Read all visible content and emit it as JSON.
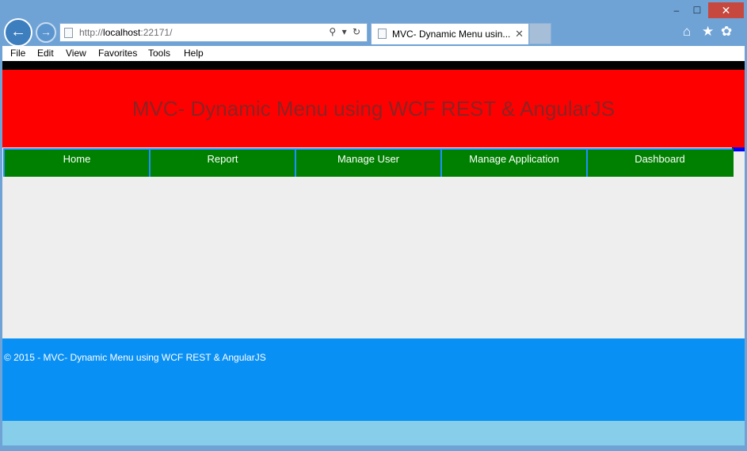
{
  "window": {
    "minimize_glyph": "–",
    "maximize_glyph": "☐",
    "close_glyph": "✕"
  },
  "browser": {
    "address": {
      "prefix": "http://",
      "host": "localhost",
      "port": ":22171/",
      "search_glyph": "⚲",
      "dropdown_glyph": "▾",
      "refresh_glyph": "↻"
    },
    "tab": {
      "title": "MVC- Dynamic Menu usin...",
      "close_glyph": "✕"
    },
    "icons": [
      "home-icon",
      "favorites-star-icon",
      "settings-gear-icon"
    ],
    "home_glyph": "⌂",
    "star_glyph": "★",
    "gear_glyph": "✿",
    "back_glyph": "←",
    "forward_glyph": "→"
  },
  "menubar": {
    "items": [
      "File",
      "Edit",
      "View",
      "Favorites",
      "Tools",
      "Help"
    ]
  },
  "page": {
    "banner_title": "MVC- Dynamic Menu using WCF REST & AngularJS",
    "nav": [
      "Home",
      "Report",
      "Manage User",
      "Manage Application",
      "Dashboard"
    ],
    "footer_text": "© 2015 - MVC- Dynamic Menu using WCF REST & AngularJS"
  },
  "colors": {
    "banner": "#ff0000",
    "banner_text": "#8a2424",
    "nav_bg": "#008000",
    "nav_border": "#1e90ff",
    "footer": "#0990f5",
    "footer_bottom": "#87ceeb",
    "page_bg": "#eeeeee"
  }
}
